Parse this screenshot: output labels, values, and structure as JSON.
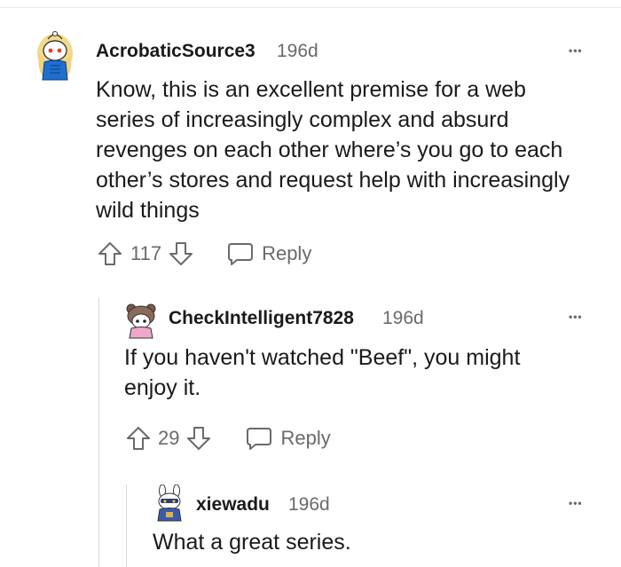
{
  "comments": [
    {
      "username": "AcrobaticSource3",
      "age": "196d",
      "body": "Know, this is an excellent premise for a web series of increasingly complex and absurd revenges on each other where’s you go to each other’s stores and request help with increasingly wild things",
      "score": "117",
      "reply_label": "Reply",
      "more_label": "•••",
      "avatar_icon": "snoo-avatar-blonde-hair-blue-hoodie"
    },
    {
      "username": "CheckIntelligent7828",
      "age": "196d",
      "body": "If you haven't watched \"Beef\", you might enjoy it.",
      "score": "29",
      "reply_label": "Reply",
      "more_label": "•••",
      "avatar_icon": "snoo-avatar-bear-hat-pink"
    },
    {
      "username": "xiewadu",
      "age": "196d",
      "body": "What a great series.",
      "more_label": "•••",
      "avatar_icon": "snoo-avatar-bunny-ears-blue"
    }
  ],
  "colors": {
    "text": "#1a1a1b",
    "meta": "#6a6a6a",
    "thread_line": "#d9d9d9"
  }
}
